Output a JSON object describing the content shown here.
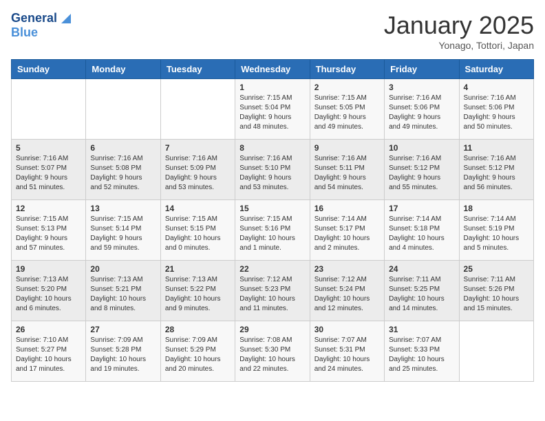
{
  "header": {
    "logo_line1": "General",
    "logo_line2": "Blue",
    "month": "January 2025",
    "location": "Yonago, Tottori, Japan"
  },
  "days_of_week": [
    "Sunday",
    "Monday",
    "Tuesday",
    "Wednesday",
    "Thursday",
    "Friday",
    "Saturday"
  ],
  "weeks": [
    [
      {
        "day": "",
        "info": ""
      },
      {
        "day": "",
        "info": ""
      },
      {
        "day": "",
        "info": ""
      },
      {
        "day": "1",
        "info": "Sunrise: 7:15 AM\nSunset: 5:04 PM\nDaylight: 9 hours\nand 48 minutes."
      },
      {
        "day": "2",
        "info": "Sunrise: 7:15 AM\nSunset: 5:05 PM\nDaylight: 9 hours\nand 49 minutes."
      },
      {
        "day": "3",
        "info": "Sunrise: 7:16 AM\nSunset: 5:06 PM\nDaylight: 9 hours\nand 49 minutes."
      },
      {
        "day": "4",
        "info": "Sunrise: 7:16 AM\nSunset: 5:06 PM\nDaylight: 9 hours\nand 50 minutes."
      }
    ],
    [
      {
        "day": "5",
        "info": "Sunrise: 7:16 AM\nSunset: 5:07 PM\nDaylight: 9 hours\nand 51 minutes."
      },
      {
        "day": "6",
        "info": "Sunrise: 7:16 AM\nSunset: 5:08 PM\nDaylight: 9 hours\nand 52 minutes."
      },
      {
        "day": "7",
        "info": "Sunrise: 7:16 AM\nSunset: 5:09 PM\nDaylight: 9 hours\nand 53 minutes."
      },
      {
        "day": "8",
        "info": "Sunrise: 7:16 AM\nSunset: 5:10 PM\nDaylight: 9 hours\nand 53 minutes."
      },
      {
        "day": "9",
        "info": "Sunrise: 7:16 AM\nSunset: 5:11 PM\nDaylight: 9 hours\nand 54 minutes."
      },
      {
        "day": "10",
        "info": "Sunrise: 7:16 AM\nSunset: 5:12 PM\nDaylight: 9 hours\nand 55 minutes."
      },
      {
        "day": "11",
        "info": "Sunrise: 7:16 AM\nSunset: 5:12 PM\nDaylight: 9 hours\nand 56 minutes."
      }
    ],
    [
      {
        "day": "12",
        "info": "Sunrise: 7:15 AM\nSunset: 5:13 PM\nDaylight: 9 hours\nand 57 minutes."
      },
      {
        "day": "13",
        "info": "Sunrise: 7:15 AM\nSunset: 5:14 PM\nDaylight: 9 hours\nand 59 minutes."
      },
      {
        "day": "14",
        "info": "Sunrise: 7:15 AM\nSunset: 5:15 PM\nDaylight: 10 hours\nand 0 minutes."
      },
      {
        "day": "15",
        "info": "Sunrise: 7:15 AM\nSunset: 5:16 PM\nDaylight: 10 hours\nand 1 minute."
      },
      {
        "day": "16",
        "info": "Sunrise: 7:14 AM\nSunset: 5:17 PM\nDaylight: 10 hours\nand 2 minutes."
      },
      {
        "day": "17",
        "info": "Sunrise: 7:14 AM\nSunset: 5:18 PM\nDaylight: 10 hours\nand 4 minutes."
      },
      {
        "day": "18",
        "info": "Sunrise: 7:14 AM\nSunset: 5:19 PM\nDaylight: 10 hours\nand 5 minutes."
      }
    ],
    [
      {
        "day": "19",
        "info": "Sunrise: 7:13 AM\nSunset: 5:20 PM\nDaylight: 10 hours\nand 6 minutes."
      },
      {
        "day": "20",
        "info": "Sunrise: 7:13 AM\nSunset: 5:21 PM\nDaylight: 10 hours\nand 8 minutes."
      },
      {
        "day": "21",
        "info": "Sunrise: 7:13 AM\nSunset: 5:22 PM\nDaylight: 10 hours\nand 9 minutes."
      },
      {
        "day": "22",
        "info": "Sunrise: 7:12 AM\nSunset: 5:23 PM\nDaylight: 10 hours\nand 11 minutes."
      },
      {
        "day": "23",
        "info": "Sunrise: 7:12 AM\nSunset: 5:24 PM\nDaylight: 10 hours\nand 12 minutes."
      },
      {
        "day": "24",
        "info": "Sunrise: 7:11 AM\nSunset: 5:25 PM\nDaylight: 10 hours\nand 14 minutes."
      },
      {
        "day": "25",
        "info": "Sunrise: 7:11 AM\nSunset: 5:26 PM\nDaylight: 10 hours\nand 15 minutes."
      }
    ],
    [
      {
        "day": "26",
        "info": "Sunrise: 7:10 AM\nSunset: 5:27 PM\nDaylight: 10 hours\nand 17 minutes."
      },
      {
        "day": "27",
        "info": "Sunrise: 7:09 AM\nSunset: 5:28 PM\nDaylight: 10 hours\nand 19 minutes."
      },
      {
        "day": "28",
        "info": "Sunrise: 7:09 AM\nSunset: 5:29 PM\nDaylight: 10 hours\nand 20 minutes."
      },
      {
        "day": "29",
        "info": "Sunrise: 7:08 AM\nSunset: 5:30 PM\nDaylight: 10 hours\nand 22 minutes."
      },
      {
        "day": "30",
        "info": "Sunrise: 7:07 AM\nSunset: 5:31 PM\nDaylight: 10 hours\nand 24 minutes."
      },
      {
        "day": "31",
        "info": "Sunrise: 7:07 AM\nSunset: 5:33 PM\nDaylight: 10 hours\nand 25 minutes."
      },
      {
        "day": "",
        "info": ""
      }
    ]
  ]
}
